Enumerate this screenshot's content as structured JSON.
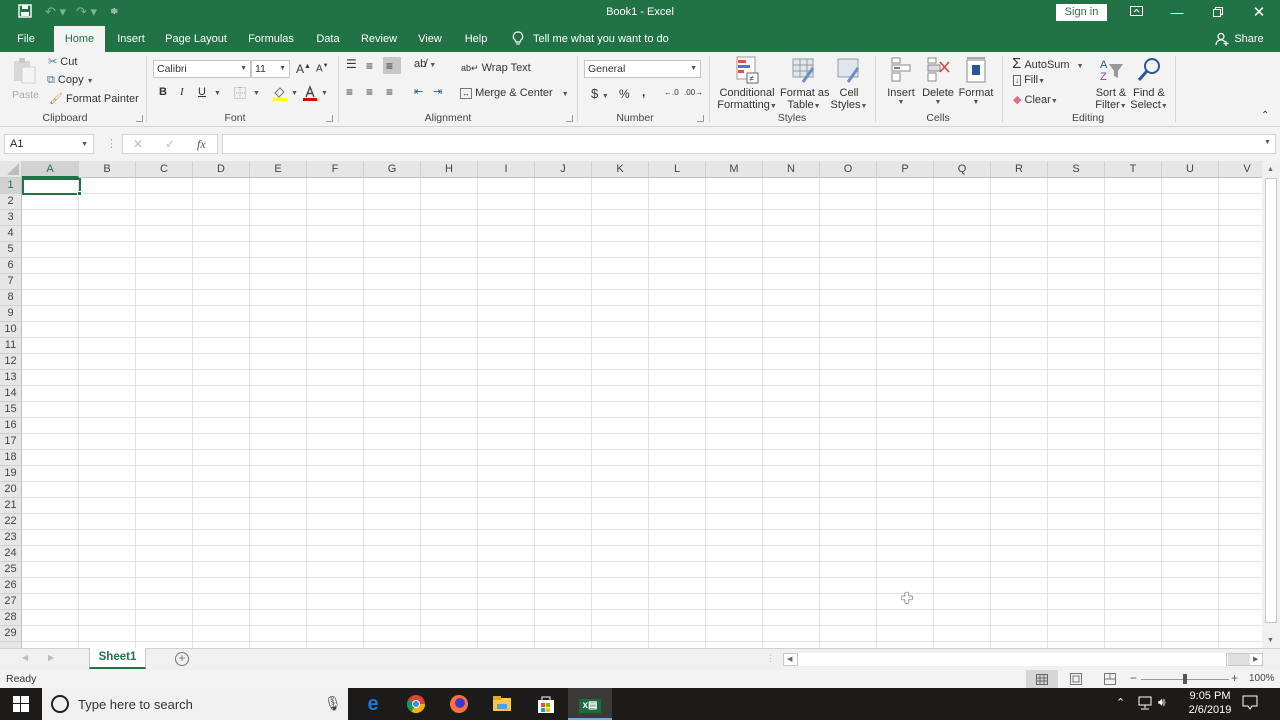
{
  "window": {
    "title": "Book1  -  Excel",
    "sign_in": "Sign in",
    "quick_access": {
      "save_icon": "save-icon",
      "undo_icon": "undo-icon",
      "redo_icon": "redo-icon",
      "customize_icon": "customize-qat-icon"
    }
  },
  "tabs": [
    {
      "label": "File",
      "active": false
    },
    {
      "label": "Home",
      "active": true
    },
    {
      "label": "Insert",
      "active": false
    },
    {
      "label": "Page Layout",
      "active": false
    },
    {
      "label": "Formulas",
      "active": false
    },
    {
      "label": "Data",
      "active": false
    },
    {
      "label": "Review",
      "active": false
    },
    {
      "label": "View",
      "active": false
    },
    {
      "label": "Help",
      "active": false
    }
  ],
  "tell_me": "Tell me what you want to do",
  "share": "Share",
  "ribbon": {
    "clipboard": {
      "label": "Clipboard",
      "paste": "Paste",
      "cut": "Cut",
      "copy": "Copy",
      "format_painter": "Format Painter"
    },
    "font": {
      "label": "Font",
      "font_name": "Calibri",
      "font_size": "11",
      "bold": "B",
      "italic": "I",
      "underline": "U"
    },
    "alignment": {
      "label": "Alignment",
      "wrap_text": "Wrap Text",
      "merge_center": "Merge & Center"
    },
    "number": {
      "label": "Number",
      "format": "General",
      "currency": "$",
      "percent": "%",
      "comma": ","
    },
    "styles": {
      "label": "Styles",
      "conditional_1": "Conditional",
      "conditional_2": "Formatting",
      "format_table_1": "Format as",
      "format_table_2": "Table",
      "cell_styles_1": "Cell",
      "cell_styles_2": "Styles"
    },
    "cells": {
      "label": "Cells",
      "insert": "Insert",
      "delete": "Delete",
      "format": "Format"
    },
    "editing": {
      "label": "Editing",
      "autosum": "AutoSum",
      "fill": "Fill",
      "clear": "Clear",
      "sort_1": "Sort &",
      "sort_2": "Filter",
      "find_1": "Find &",
      "find_2": "Select"
    }
  },
  "formula_bar": {
    "name_box": "A1",
    "formula": "",
    "fx": "fx"
  },
  "grid": {
    "columns": [
      "A",
      "B",
      "C",
      "D",
      "E",
      "F",
      "G",
      "H",
      "I",
      "J",
      "K",
      "L",
      "M",
      "N",
      "O",
      "P",
      "Q",
      "R",
      "S",
      "T",
      "U",
      "V"
    ],
    "rows": [
      "1",
      "2",
      "3",
      "4",
      "5",
      "6",
      "7",
      "8",
      "9",
      "10",
      "11",
      "12",
      "13",
      "14",
      "15",
      "16",
      "17",
      "18",
      "19",
      "20",
      "21",
      "22",
      "23",
      "24",
      "25",
      "26",
      "27",
      "28",
      "29"
    ],
    "active_cell": "A1"
  },
  "sheets": [
    {
      "name": "Sheet1",
      "active": true
    }
  ],
  "status": {
    "ready": "Ready",
    "zoom": "100%",
    "zoom_level": 1.0
  },
  "taskbar": {
    "search_placeholder": "Type here to search",
    "time": "9:05 PM",
    "date": "2/6/2019",
    "apps": [
      "edge",
      "chrome",
      "firefox",
      "file-explorer",
      "store",
      "excel"
    ]
  },
  "colors": {
    "accent": "#217346"
  }
}
